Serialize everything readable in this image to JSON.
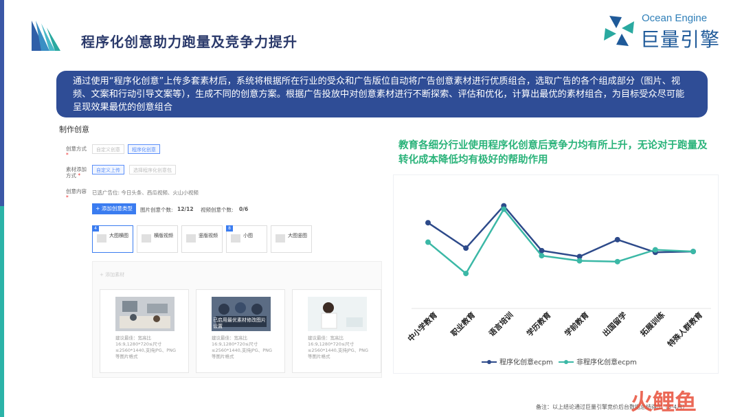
{
  "title": "程序化创意助力跑量及竞争力提升",
  "brand": {
    "en": "Ocean Engine",
    "cn": "巨量引擎"
  },
  "banner_text": "通过使用“程序化创意”上传多套素材后，系统将根据所在行业的受众和广告版位自动将广告创意素材进行优质组合，选取广告的各个组成部分（图片、视频、文案和行动引导文案等），生成不同的创意方案。根据广告投放中对创意素材进行不断探索、评估和优化，计算出最优的素材组合，为目标受众尽可能呈现效果最优的创意组合",
  "panel": {
    "title": "制作创意",
    "rows": [
      {
        "label": "创意方式",
        "options": [
          "自定义创意",
          "程序化创意"
        ]
      },
      {
        "label": "素材添加方式",
        "options": [
          "自定义上传",
          "选择程序化创意包"
        ]
      },
      {
        "label": "创意内容",
        "value": "已选广告位: 今日头条、西瓜视频、火山小视频"
      }
    ],
    "add_button": "+ 添加创意类型",
    "img_count_label": "图片创意个数:",
    "img_count": "12/12",
    "video_count_label": "视频创意个数:",
    "video_count": "0/6",
    "types": [
      {
        "num": "4",
        "label": "大图横图"
      },
      {
        "num": "",
        "label": "横版视频"
      },
      {
        "num": "",
        "label": "竖版视频"
      },
      {
        "num": "8",
        "label": "小图"
      },
      {
        "num": "",
        "label": "大图竖图"
      }
    ],
    "area_tab": "+ 添加素材",
    "materials": [
      {
        "caption": "建议最佳：宽高比16:9,1280*720≤尺寸≤2560*1440,支持JPG、PNG等图片格式",
        "overlay": ""
      },
      {
        "caption": "建议最佳：宽高比16:9,1280*720≤尺寸≤2560*1440,支持JPG、PNG等图片格式",
        "overlay": "已启用最优素材修改图片 设置"
      },
      {
        "caption": "建议最佳：宽高比16:9,1280*720≤尺寸≤2560*1440,支持JPG、PNG等图片格式",
        "overlay": ""
      }
    ]
  },
  "headline": "教育各细分行业使用程序化创意后竞争力均有所上升，无论对于跑量及转化成本降低均有极好的帮助作用",
  "chart_data": {
    "type": "line",
    "categories": [
      "中小学教育",
      "职业教育",
      "语言培训",
      "学历教育",
      "学前教育",
      "出国留学",
      "拓展训练",
      "特殊人群教育"
    ],
    "series": [
      {
        "name": "程序化创意ecpm",
        "color": "#2d4a8a",
        "values": [
          0.9,
          0.6,
          1.1,
          0.57,
          0.5,
          0.7,
          0.55,
          0.56
        ]
      },
      {
        "name": "非程序化创意ecpm",
        "color": "#3bb8a6",
        "values": [
          0.67,
          0.3,
          1.06,
          0.51,
          0.45,
          0.44,
          0.58,
          0.56
        ]
      }
    ],
    "ylim": [
      0,
      1.3
    ],
    "grid": false,
    "legend": "bottom"
  },
  "footnote": "备注：以上结论通过巨量引擎竞价后台数据总结得出（3-4月）",
  "watermark": "火鲤鱼"
}
